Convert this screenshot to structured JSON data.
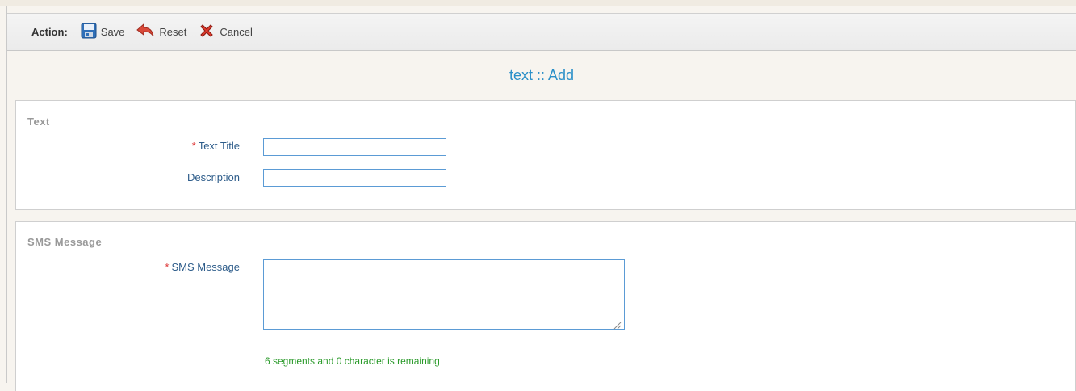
{
  "toolbar": {
    "action_label": "Action:",
    "save_label": "Save",
    "reset_label": "Reset",
    "cancel_label": "Cancel"
  },
  "page": {
    "title": "text :: Add"
  },
  "text_section": {
    "legend": "Text",
    "required_marker": "*",
    "text_title_label": "Text Title",
    "text_title_value": "",
    "description_label": "Description",
    "description_value": ""
  },
  "sms_section": {
    "legend": "SMS Message",
    "required_marker": "*",
    "sms_label": "SMS Message",
    "sms_value": "",
    "counter_text": "6 segments and 0 character is remaining"
  },
  "colors": {
    "title": "#2a8fc8",
    "label": "#2d5c8a",
    "required": "#dd3333",
    "counter": "#2a9a2a",
    "input_border": "#5b9bd5"
  }
}
